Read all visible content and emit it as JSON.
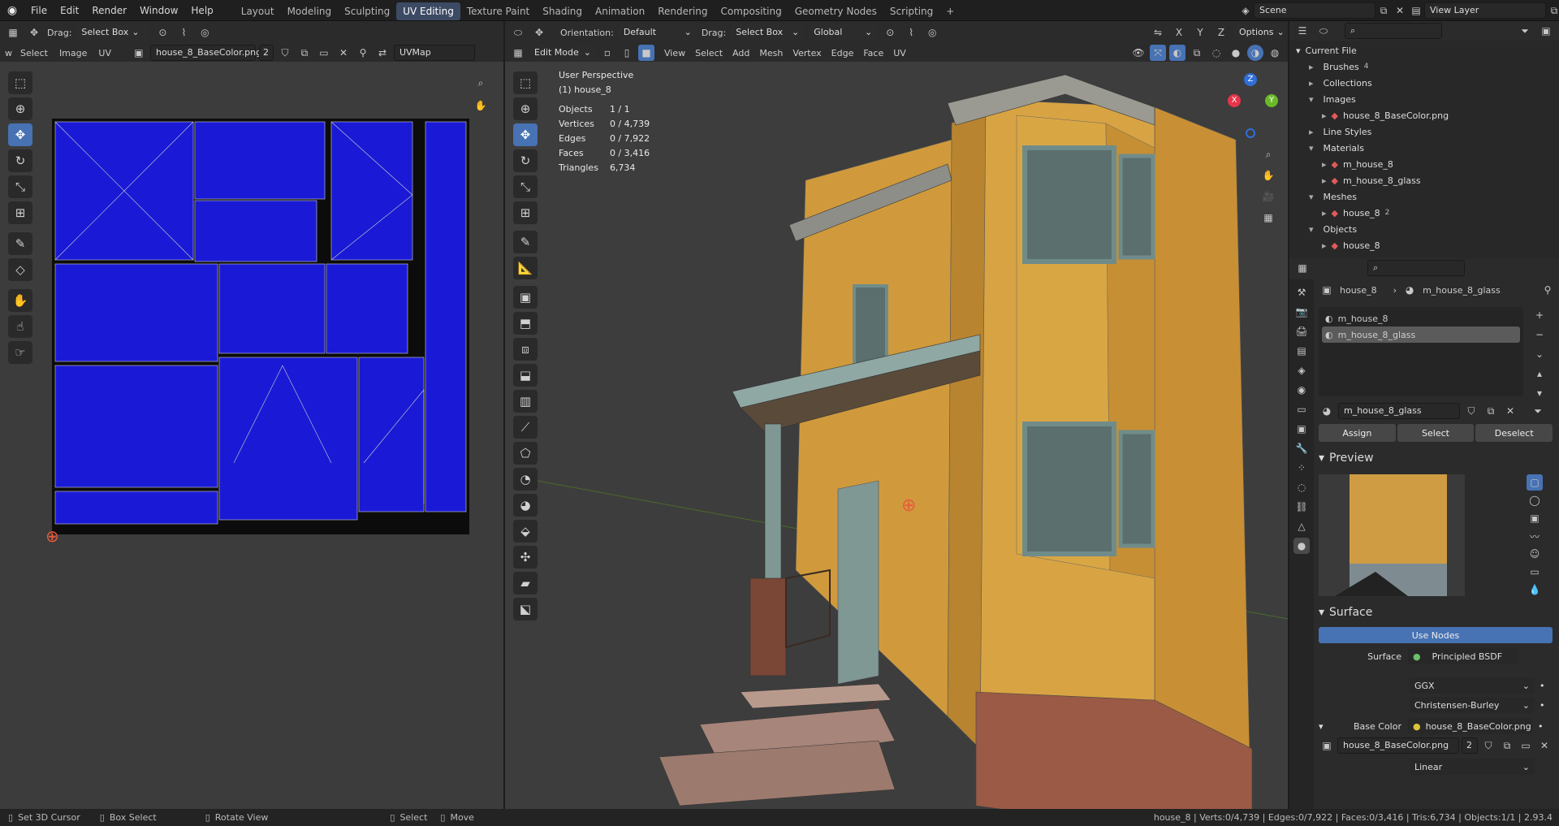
{
  "topbar": {
    "menus": [
      "File",
      "Edit",
      "Render",
      "Window",
      "Help"
    ],
    "workspaces": [
      "Layout",
      "Modeling",
      "Sculpting",
      "UV Editing",
      "Texture Paint",
      "Shading",
      "Animation",
      "Rendering",
      "Compositing",
      "Geometry Nodes",
      "Scripting"
    ],
    "active_workspace": "UV Editing",
    "scene": "Scene",
    "view_layer": "View Layer"
  },
  "uv_editor": {
    "drag_label": "Drag:",
    "drag_value": "Select Box",
    "menus": [
      "w",
      "Select",
      "Image",
      "UV"
    ],
    "image_name": "house_8_BaseColor.png",
    "image_users": "2",
    "uvmap": "UVMap"
  },
  "viewport": {
    "orientation_label": "Orientation:",
    "orientation_value": "Default",
    "drag_label": "Drag:",
    "drag_value": "Select Box",
    "transform_orientation": "Global",
    "options": "Options",
    "mode": "Edit Mode",
    "menus": [
      "View",
      "Select",
      "Add",
      "Mesh",
      "Vertex",
      "Edge",
      "Face",
      "UV"
    ],
    "perspective": "User Perspective",
    "object_label": "(1) house_8",
    "stats": [
      {
        "label": "Objects",
        "value": "1 / 1"
      },
      {
        "label": "Vertices",
        "value": "0 / 4,739"
      },
      {
        "label": "Edges",
        "value": "0 / 7,922"
      },
      {
        "label": "Faces",
        "value": "0 / 3,416"
      },
      {
        "label": "Triangles",
        "value": "6,734"
      }
    ],
    "gizmo_axes": [
      "Z",
      "X",
      "Y"
    ]
  },
  "outliner": {
    "root": "Current File",
    "items": [
      {
        "label": "Brushes",
        "level": 1,
        "count": "4"
      },
      {
        "label": "Collections",
        "level": 1
      },
      {
        "label": "Images",
        "level": 1
      },
      {
        "label": "house_8_BaseColor.png",
        "level": 2
      },
      {
        "label": "Line Styles",
        "level": 1
      },
      {
        "label": "Materials",
        "level": 1
      },
      {
        "label": "m_house_8",
        "level": 2
      },
      {
        "label": "m_house_8_glass",
        "level": 2
      },
      {
        "label": "Meshes",
        "level": 1
      },
      {
        "label": "house_8",
        "level": 2,
        "count": "2"
      },
      {
        "label": "Objects",
        "level": 1
      },
      {
        "label": "house_8",
        "level": 2
      }
    ]
  },
  "properties": {
    "object": "house_8",
    "material": "m_house_8_glass",
    "slots": [
      "m_house_8",
      "m_house_8_glass"
    ],
    "active_slot": "m_house_8_glass",
    "material_field": "m_house_8_glass",
    "assign": "Assign",
    "select": "Select",
    "deselect": "Deselect",
    "preview_title": "Preview",
    "surface_title": "Surface",
    "use_nodes": "Use Nodes",
    "surface_label": "Surface",
    "surface_value": "Principled BSDF",
    "distribution": "GGX",
    "subsurface": "Christensen-Burley",
    "base_color_label": "Base Color",
    "base_color_value": "house_8_BaseColor.png",
    "image_field": "house_8_BaseColor.png",
    "image_users": "2",
    "interpolation": "Linear"
  },
  "status": {
    "hints": [
      "Set 3D Cursor",
      "Box Select",
      "Rotate View",
      "Select",
      "Move"
    ],
    "info": "house_8 | Verts:0/4,739 | Edges:0/7,922 | Faces:0/3,416 | Tris:6,734 | Objects:1/1 | 2.93.4"
  },
  "colors": {
    "accent": "#4772b3",
    "uv_fill": "#1a1ad6",
    "wall": "#d9a441",
    "trim": "#6f8c8a",
    "brick": "#9b5a45"
  }
}
